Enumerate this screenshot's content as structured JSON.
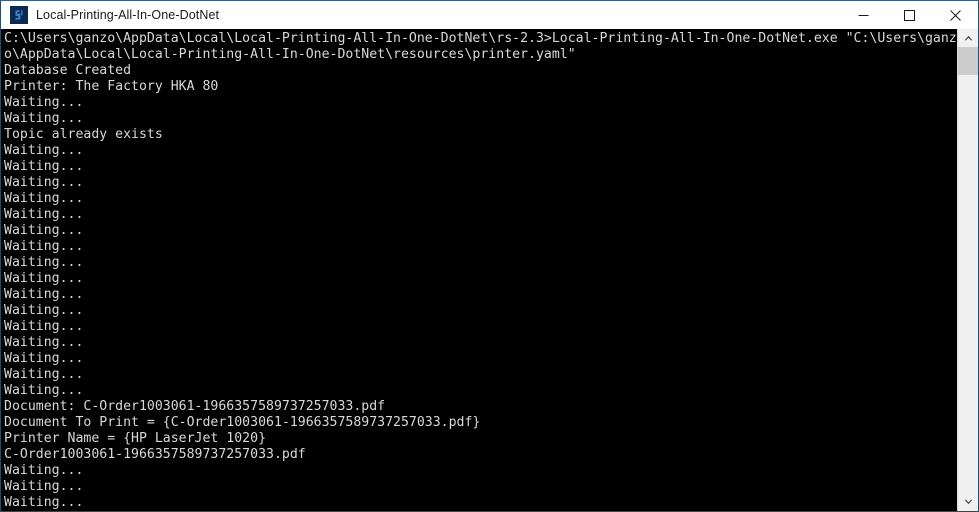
{
  "window": {
    "title": "Local-Printing-All-In-One-DotNet",
    "icon_name": "console-app-icon",
    "controls": {
      "minimize_label": "Minimize",
      "maximize_label": "Maximize",
      "close_label": "Close"
    }
  },
  "scrollbar": {
    "up_arrow_label": "Scroll up",
    "down_arrow_label": "Scroll down",
    "thumb_label": "Scroll thumb"
  },
  "console": {
    "background_color": "#000000",
    "text_color": "#d8d8d8",
    "lines": [
      "C:\\Users\\ganzo\\AppData\\Local\\Local-Printing-All-In-One-DotNet\\rs-2.3>Local-Printing-All-In-One-DotNet.exe \"C:\\Users\\ganz",
      "o\\AppData\\Local\\Local-Printing-All-In-One-DotNet\\resources\\printer.yaml\"",
      "Database Created",
      "Printer: The Factory HKA 80",
      "Waiting...",
      "Waiting...",
      "Topic already exists",
      "Waiting...",
      "Waiting...",
      "Waiting...",
      "Waiting...",
      "Waiting...",
      "Waiting...",
      "Waiting...",
      "Waiting...",
      "Waiting...",
      "Waiting...",
      "Waiting...",
      "Waiting...",
      "Waiting...",
      "Waiting...",
      "Waiting...",
      "Waiting...",
      "Document: C-Order1003061-1966357589737257033.pdf",
      "Document To Print = {C-Order1003061-1966357589737257033.pdf}",
      "Printer Name = {HP LaserJet 1020}",
      "C-Order1003061-1966357589737257033.pdf",
      "Waiting...",
      "Waiting...",
      "Waiting..."
    ]
  }
}
